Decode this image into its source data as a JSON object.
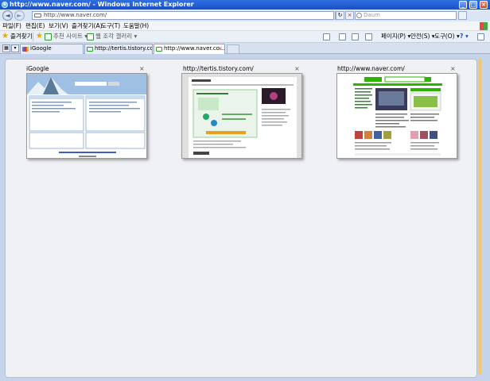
{
  "window": {
    "title": "http://www.naver.com/ - Windows Internet Explorer",
    "minimize": "_",
    "maximize": "□",
    "close": "×"
  },
  "nav": {
    "back": "◄",
    "forward": "►",
    "address": "http://www.naver.com/",
    "refresh": "↻",
    "stop": "×",
    "search_placeholder": "Daum"
  },
  "menu": {
    "items": [
      "파일(F)",
      "편집(E)",
      "보기(V)",
      "즐겨찾기(A)",
      "도구(T)",
      "도움말(H)"
    ]
  },
  "favbar": {
    "favorites": "즐겨찾기",
    "suggested": "추천 사이트 ▾",
    "webslice": "웹 조각 갤러리 ▾",
    "page": "페이지(P) ▾",
    "safety": "안전(S) ▾",
    "tools": "도구(O) ▾",
    "help": "? ▾"
  },
  "tabs": [
    {
      "label": "iGoogle",
      "active": false
    },
    {
      "label": "http://tertis.tistory.com/",
      "active": false
    },
    {
      "label": "http://www.naver.co...",
      "active": true
    }
  ],
  "thumbnails": [
    {
      "title": "iGoogle",
      "close": "×"
    },
    {
      "title": "http://tertis.tistory.com/",
      "close": "×"
    },
    {
      "title": "http://www.naver.com/",
      "close": "×"
    }
  ],
  "colors": {
    "titlebar": "#2459d8",
    "quicktabs_bg": "#c5d4eb",
    "naver_green": "#2db400"
  }
}
